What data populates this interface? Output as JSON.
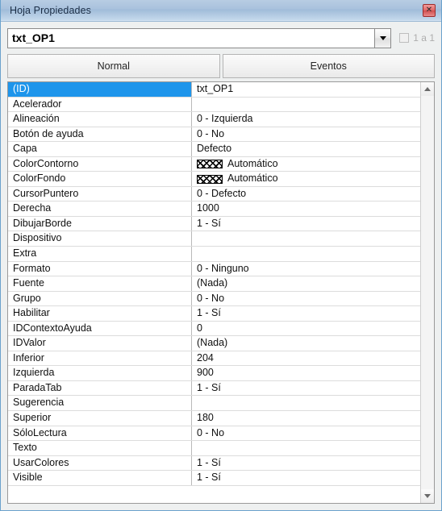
{
  "window": {
    "title": "Hoja Propiedades",
    "close_label": "✕",
    "close_icon": "close-icon"
  },
  "selector": {
    "value": "txt_OP1",
    "placeholder": "",
    "dropdown_icon": "chevron-down-icon",
    "one_to_one": {
      "label": "1 a 1",
      "checked": false,
      "enabled": false
    }
  },
  "tabs": [
    {
      "label": "Normal",
      "active": true
    },
    {
      "label": "Eventos",
      "active": false
    }
  ],
  "scrollbar": {
    "up_icon": "scroll-up-arrow-icon",
    "down_icon": "scroll-down-arrow-icon"
  },
  "grid": {
    "rows": [
      {
        "name": "(ID)",
        "value": "txt_OP1",
        "selected": true,
        "swatch": false
      },
      {
        "name": "Acelerador",
        "value": "",
        "selected": false,
        "swatch": false
      },
      {
        "name": "Alineación",
        "value": "0 - Izquierda",
        "selected": false,
        "swatch": false
      },
      {
        "name": "Botón de ayuda",
        "value": "0 - No",
        "selected": false,
        "swatch": false
      },
      {
        "name": "Capa",
        "value": "Defecto",
        "selected": false,
        "swatch": false
      },
      {
        "name": "ColorContorno",
        "value": "Automático",
        "selected": false,
        "swatch": true
      },
      {
        "name": "ColorFondo",
        "value": "Automático",
        "selected": false,
        "swatch": true
      },
      {
        "name": "CursorPuntero",
        "value": "0 - Defecto",
        "selected": false,
        "swatch": false
      },
      {
        "name": "Derecha",
        "value": "1000",
        "selected": false,
        "swatch": false
      },
      {
        "name": "DibujarBorde",
        "value": "1 - Sí",
        "selected": false,
        "swatch": false
      },
      {
        "name": "Dispositivo",
        "value": "",
        "selected": false,
        "swatch": false
      },
      {
        "name": "Extra",
        "value": "",
        "selected": false,
        "swatch": false
      },
      {
        "name": "Formato",
        "value": "0 - Ninguno",
        "selected": false,
        "swatch": false
      },
      {
        "name": "Fuente",
        "value": "(Nada)",
        "selected": false,
        "swatch": false
      },
      {
        "name": "Grupo",
        "value": "0 - No",
        "selected": false,
        "swatch": false
      },
      {
        "name": "Habilitar",
        "value": "1 - Sí",
        "selected": false,
        "swatch": false
      },
      {
        "name": "IDContextoAyuda",
        "value": "0",
        "selected": false,
        "swatch": false
      },
      {
        "name": "IDValor",
        "value": "(Nada)",
        "selected": false,
        "swatch": false
      },
      {
        "name": "Inferior",
        "value": "204",
        "selected": false,
        "swatch": false
      },
      {
        "name": "Izquierda",
        "value": "900",
        "selected": false,
        "swatch": false
      },
      {
        "name": "ParadaTab",
        "value": "1 - Sí",
        "selected": false,
        "swatch": false
      },
      {
        "name": "Sugerencia",
        "value": "",
        "selected": false,
        "swatch": false
      },
      {
        "name": "Superior",
        "value": "180",
        "selected": false,
        "swatch": false
      },
      {
        "name": "SóloLectura",
        "value": "0 - No",
        "selected": false,
        "swatch": false
      },
      {
        "name": "Texto",
        "value": "",
        "selected": false,
        "swatch": false
      },
      {
        "name": "UsarColores",
        "value": "1 - Sí",
        "selected": false,
        "swatch": false
      },
      {
        "name": "Visible",
        "value": "1 - Sí",
        "selected": false,
        "swatch": false
      }
    ]
  },
  "colors": {
    "selection_blue": "#1e95eb",
    "titlebar_blue": "#a9c2dd",
    "frame_blue": "#6ba2cd",
    "close_red": "#d14f4f",
    "grid_line": "#dcdcdc"
  }
}
